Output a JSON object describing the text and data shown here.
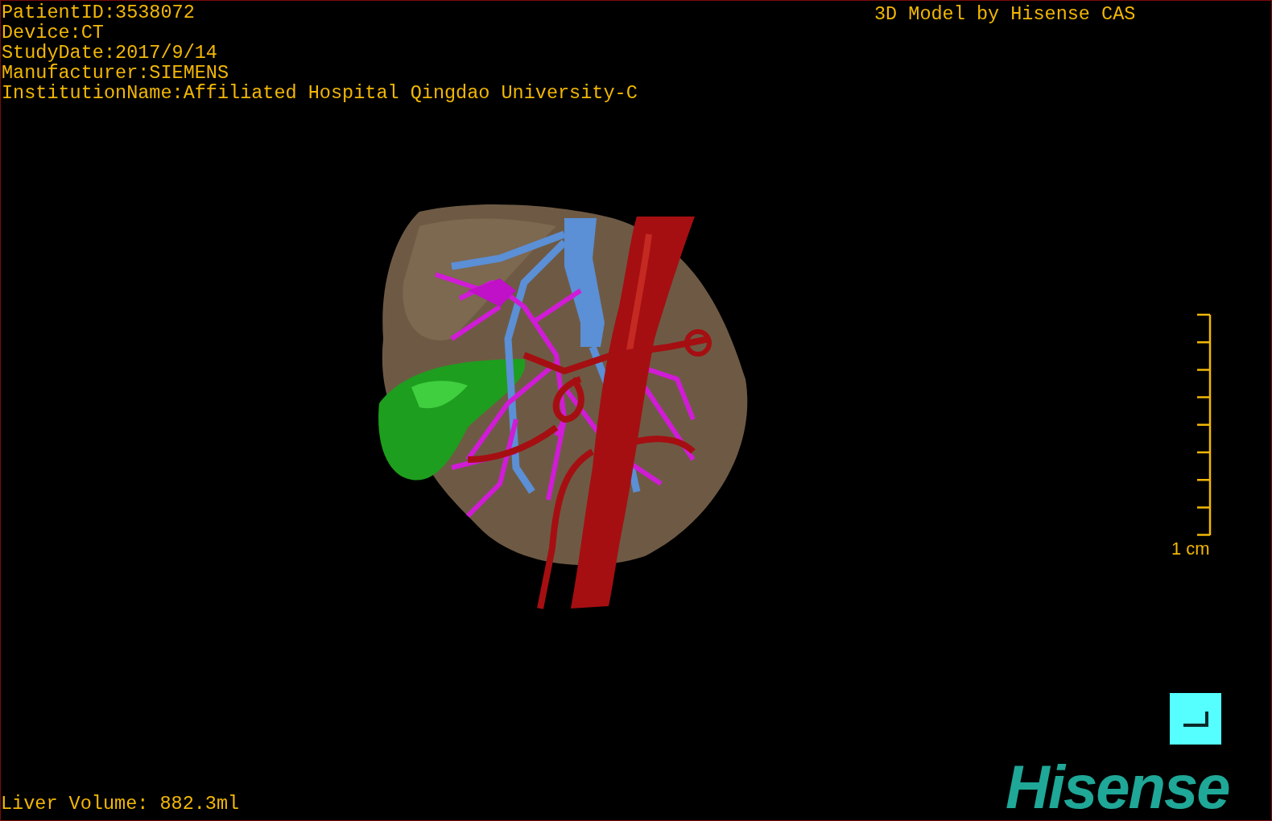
{
  "patient_info": [
    "PatientID:3538072",
    "Device:CT",
    "StudyDate:2017/9/14",
    "Manufacturer:SIEMENS",
    "InstitutionName:Affiliated Hospital Qingdao University-C"
  ],
  "title": "3D Model by Hisense CAS",
  "scale_bar": {
    "label": "1 cm"
  },
  "liver_volume": "Liver Volume: 882.3ml",
  "logo": "Hisense"
}
